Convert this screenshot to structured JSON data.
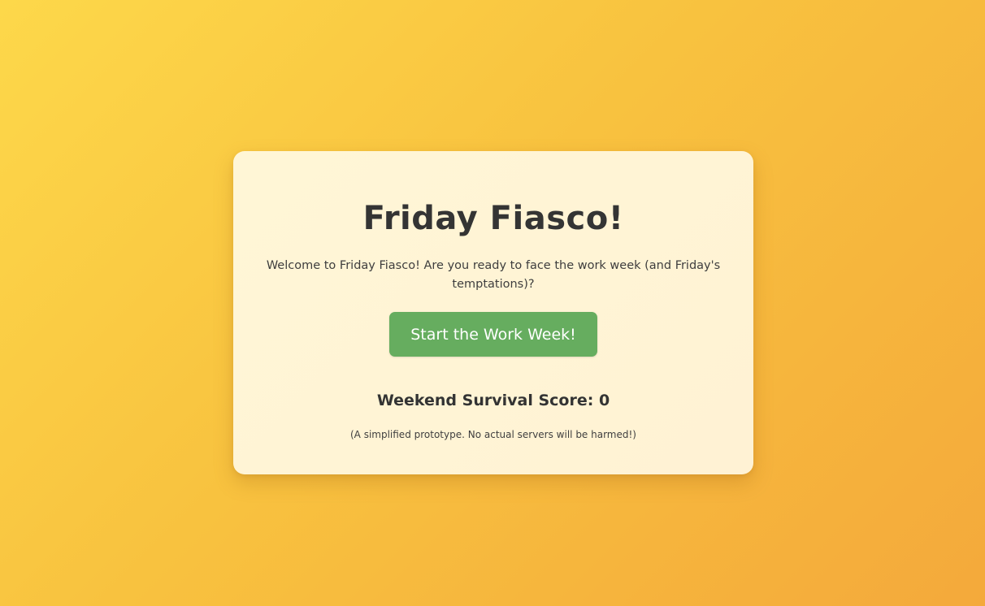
{
  "game": {
    "title": "Friday Fiasco!",
    "welcome_text": "Welcome to Friday Fiasco! Are you ready to face the work week (and Friday's temptations)?",
    "start_button_label": "Start the Work Week!",
    "score_label": "Weekend Survival Score:",
    "score_value": "0",
    "footnote": "(A simplified prototype. No actual servers will be harmed!)"
  },
  "colors": {
    "background_start": "#fdd84a",
    "background_end": "#f4a93b",
    "card_background": "#fff6d6",
    "button_green": "#66ad5f",
    "text_dark": "#343434"
  }
}
